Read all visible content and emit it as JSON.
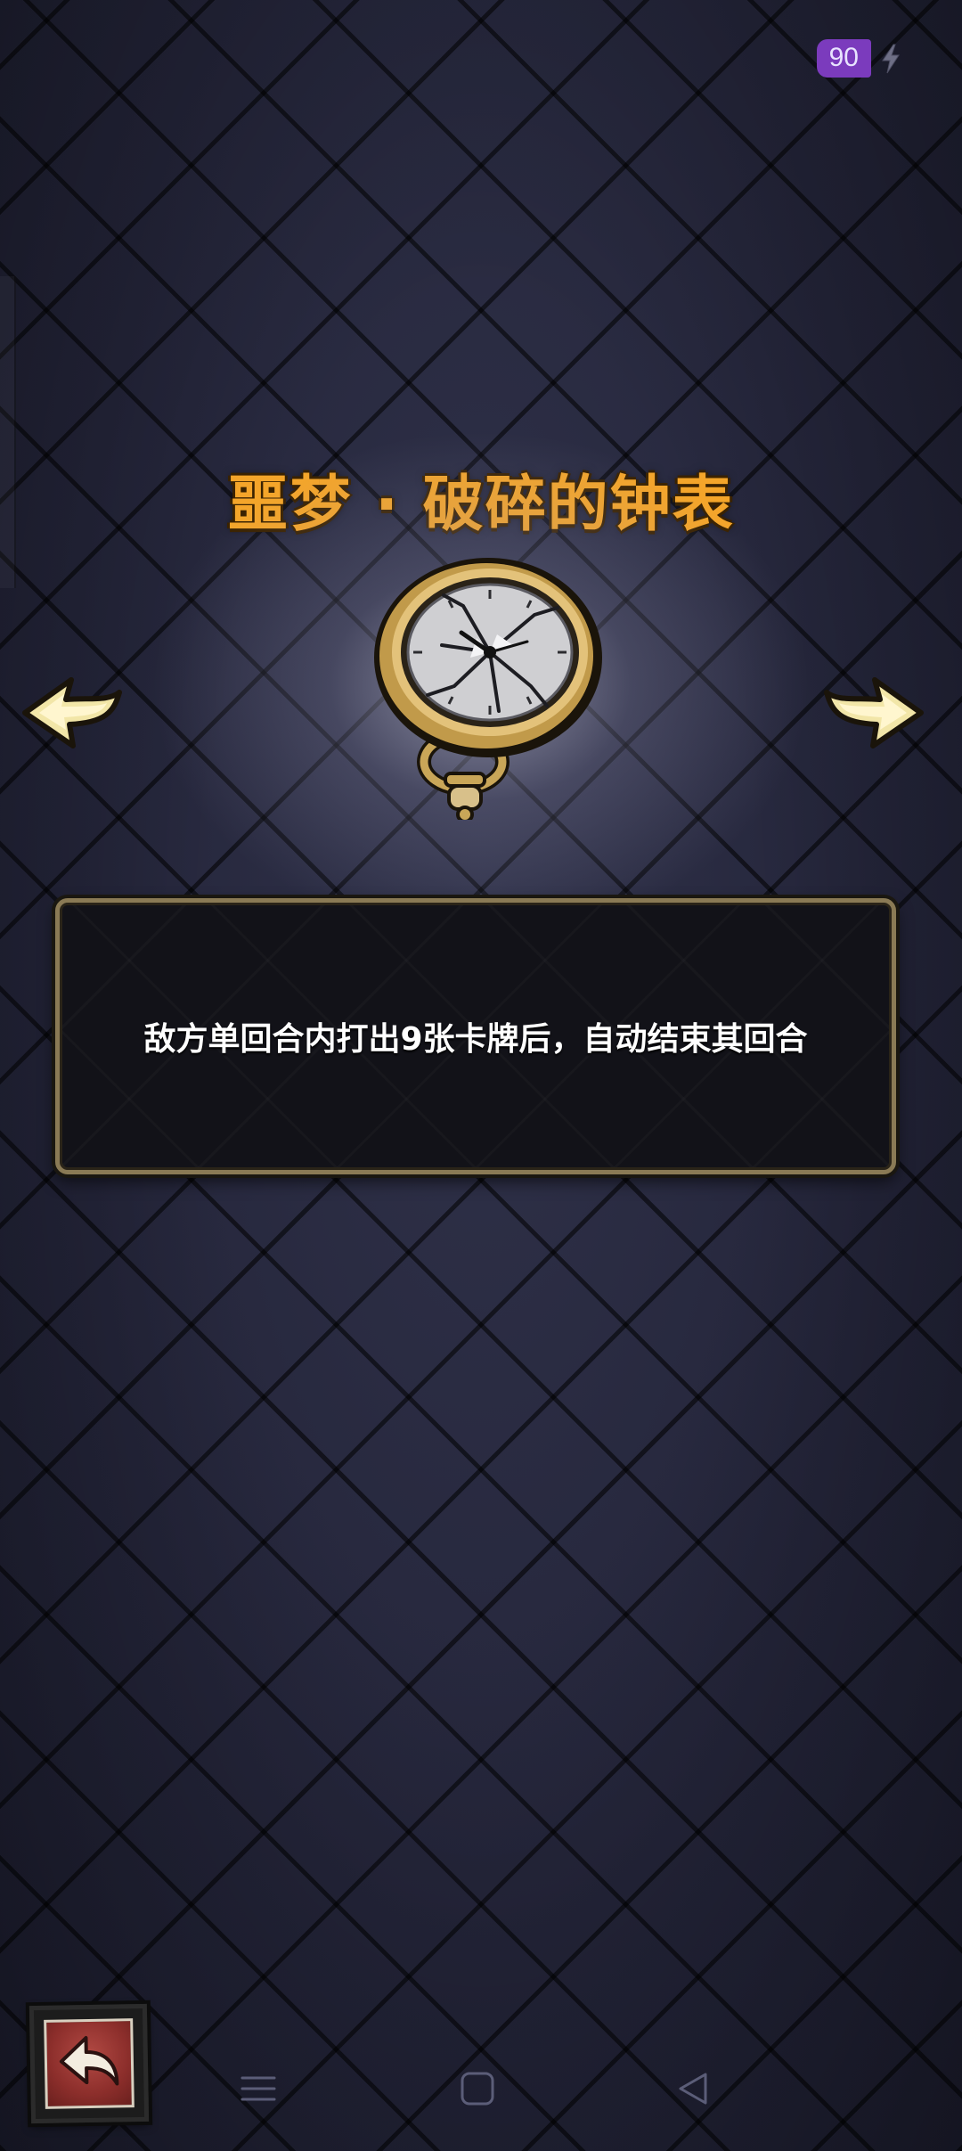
{
  "status": {
    "energy_value": "90",
    "energy_icon": "lightning-bolt-icon"
  },
  "relic": {
    "title": "噩梦 · 破碎的钟表",
    "image_icon": "broken-pocket-watch-icon",
    "description": "敌方单回合内打出9张卡牌后，自动结束其回合"
  },
  "navigation": {
    "prev_icon": "arrow-left-icon",
    "next_icon": "arrow-right-icon",
    "back_icon": "return-arrow-icon"
  },
  "system_nav": {
    "menu_icon": "menu-icon",
    "home_icon": "home-square-icon",
    "back_icon": "back-triangle-icon"
  },
  "colors": {
    "title": "#f4a52a",
    "energy_badge": "#7b3bbd",
    "panel_border": "#8a7a55",
    "background": "#262739"
  }
}
